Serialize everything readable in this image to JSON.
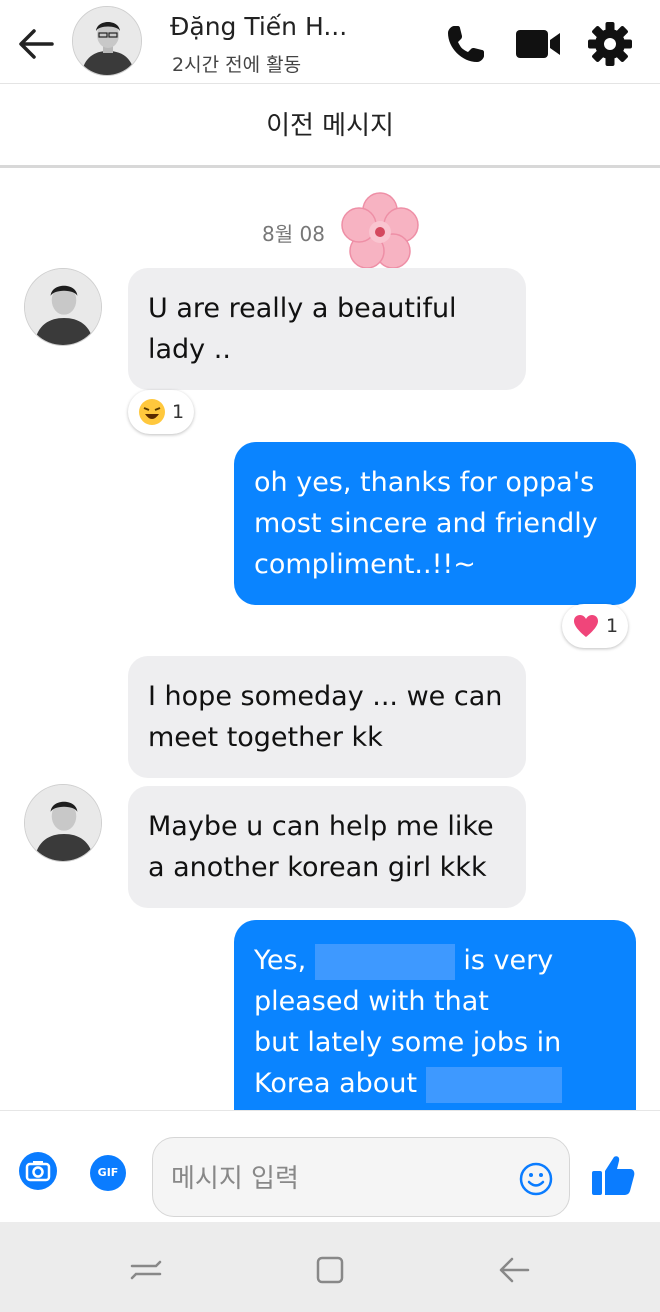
{
  "header": {
    "contact_name": "Đặng Tiến H...",
    "status": "2시간 전에 활동",
    "icons": [
      "back-arrow-icon",
      "phone-icon",
      "video-icon",
      "gear-icon"
    ]
  },
  "earlier_messages_label": "이전 메시지",
  "date_label": "8월 08",
  "messages": [
    {
      "direction": "incoming",
      "text_lines": [
        "U are really a beautiful",
        "lady .."
      ],
      "reaction": {
        "emoji": "laughing-face",
        "count": "1"
      }
    },
    {
      "direction": "outgoing",
      "text_lines": [
        "oh yes, thanks for oppa's",
        "most sincere and friendly",
        "compliment..!!~"
      ],
      "reaction": {
        "emoji": "heart",
        "count": "1"
      }
    },
    {
      "direction": "incoming",
      "text_lines": [
        "I hope someday ... we can",
        "meet together kk"
      ]
    },
    {
      "direction": "incoming",
      "text_lines": [
        "Maybe u can help me like",
        "a another korean girl kkk"
      ]
    },
    {
      "direction": "outgoing",
      "text_lines": [
        "Yes,",
        "is very",
        "pleased with that",
        "but lately some jobs in",
        "Korea about"
      ]
    }
  ],
  "composer": {
    "placeholder": "메시지 입력",
    "gif_label": "GIF",
    "icons": [
      "camera-icon",
      "gif-icon",
      "emoji-icon",
      "thumbs-up-icon"
    ]
  },
  "colors": {
    "accent": "#0a84ff",
    "incoming_bubble": "#eeeef0",
    "text": "#111111"
  }
}
